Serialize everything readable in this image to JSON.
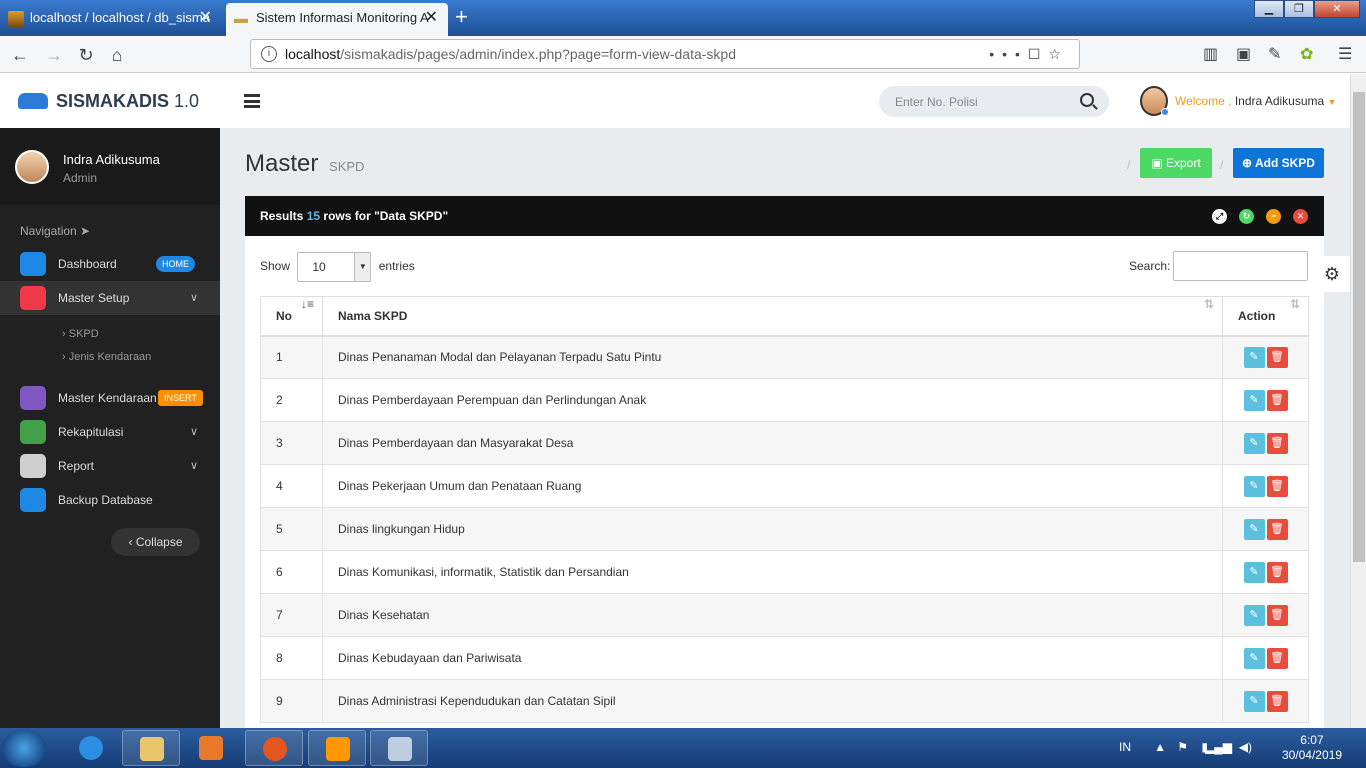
{
  "browser": {
    "tabs": [
      {
        "title": "localhost / localhost / db_sisma"
      },
      {
        "title": "Sistem Informasi Monitoring A"
      }
    ],
    "url_host": "localhost",
    "url_path": "/sismakadis/pages/admin/index.php?page=form-view-data-skpd"
  },
  "header": {
    "brand": "SISMAKADIS",
    "version": "1.0",
    "search_placeholder": "Enter No. Polisi",
    "welcome": "Welcome ,",
    "user_name": "Indra Adikusuma"
  },
  "sidebar": {
    "user_name": "Indra Adikusuma",
    "user_role": "Admin",
    "nav_label": "Navigation",
    "items": [
      {
        "label": "Dashboard",
        "badge": "HOME",
        "color": "#1e88e5"
      },
      {
        "label": "Master Setup",
        "color": "#f03a4a"
      },
      {
        "label": "Master Kendaraan",
        "badge": "INSERT",
        "color": "#7e57c2"
      },
      {
        "label": "Rekapitulasi",
        "color": "#43a047"
      },
      {
        "label": "Report",
        "color": "#cfcfcf"
      },
      {
        "label": "Backup Database",
        "color": "#1e88e5"
      }
    ],
    "subitems": [
      "SKPD",
      "Jenis Kendaraan"
    ],
    "collapse_label": "Collapse"
  },
  "page": {
    "title": "Master",
    "subtitle": "SKPD",
    "export_label": "Export",
    "add_label": "Add SKPD"
  },
  "panel": {
    "results_prefix": "Results",
    "results_count": "15",
    "results_suffix": "rows for \"Data SKPD\"",
    "show_label": "Show",
    "entries_value": "10",
    "entries_label": "entries",
    "search_label": "Search:"
  },
  "table": {
    "columns": [
      "No",
      "Nama SKPD",
      "Action"
    ],
    "rows": [
      {
        "no": "1",
        "nama": "Dinas Penanaman Modal dan Pelayanan Terpadu Satu Pintu"
      },
      {
        "no": "2",
        "nama": "Dinas Pemberdayaan Perempuan dan Perlindungan Anak"
      },
      {
        "no": "3",
        "nama": "Dinas Pemberdayaan dan Masyarakat Desa"
      },
      {
        "no": "4",
        "nama": "Dinas Pekerjaan Umum dan Penataan Ruang"
      },
      {
        "no": "5",
        "nama": "Dinas lingkungan Hidup"
      },
      {
        "no": "6",
        "nama": "Dinas Komunikasi, informatik, Statistik dan Persandian"
      },
      {
        "no": "7",
        "nama": "Dinas Kesehatan"
      },
      {
        "no": "8",
        "nama": "Dinas Kebudayaan dan Pariwisata"
      },
      {
        "no": "9",
        "nama": "Dinas Administrasi Kependudukan dan Catatan Sipil"
      }
    ]
  },
  "taskbar": {
    "lang": "IN",
    "time": "6:07",
    "date": "30/04/2019"
  }
}
